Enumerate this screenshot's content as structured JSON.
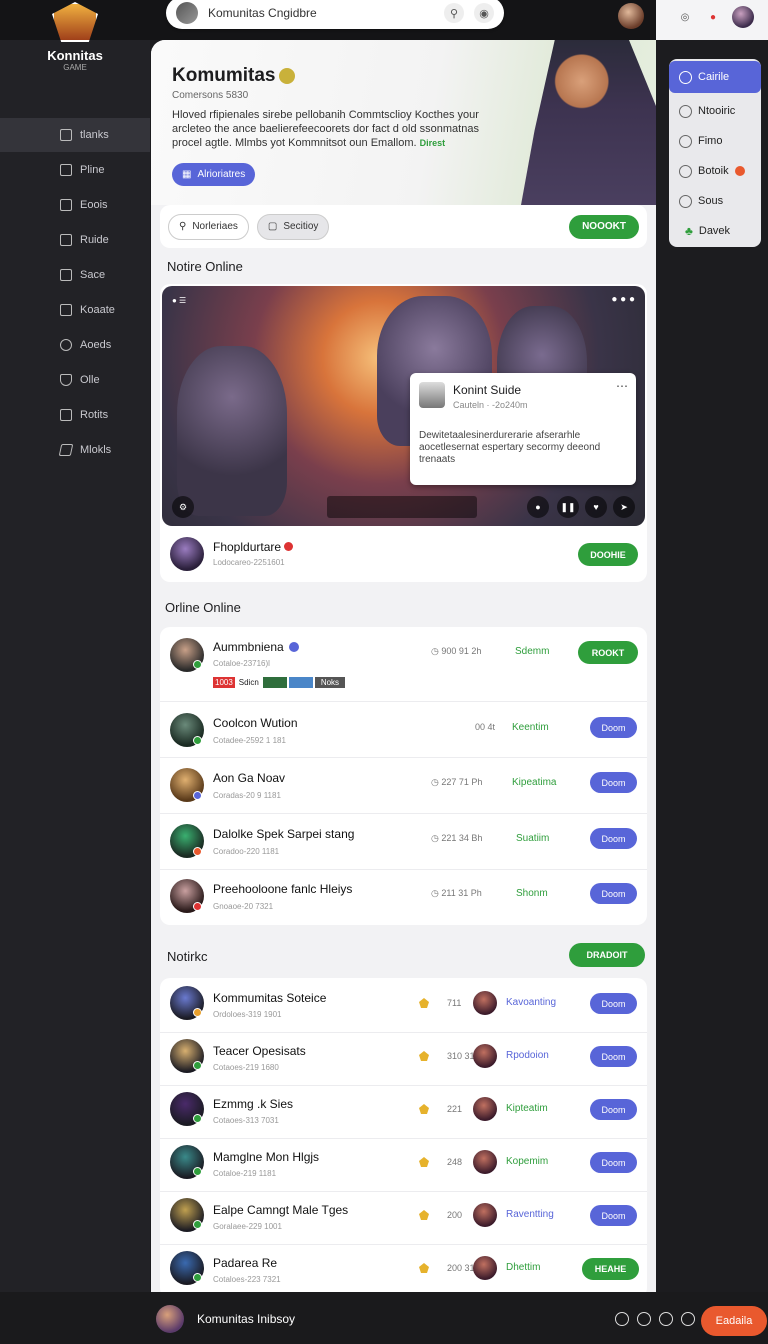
{
  "topbar": {
    "search_text": "Komunitas Cngidbre"
  },
  "sidebar": {
    "logo_title": "Konnitas",
    "logo_sub": "GAME",
    "items": [
      {
        "label": "tlanks"
      },
      {
        "label": "Pline"
      },
      {
        "label": "Eoois"
      },
      {
        "label": "Ruide"
      },
      {
        "label": "Sace"
      },
      {
        "label": "Koaate"
      },
      {
        "label": "Aoeds"
      },
      {
        "label": "Olle"
      },
      {
        "label": "Rotits"
      },
      {
        "label": "Mlokls"
      }
    ]
  },
  "hero": {
    "title": "Komumitas",
    "subtitle": "Comersons 5830",
    "description": "Hloved rfipienales sirebe pellobanih Commtsclioy Kocthes your arcleteo the ance baelierefeecoorets dor fact d old ssonmatnas procel agtle. Mlmbs yot Kommnitsot oun Emallom.",
    "description_tag": "Direst",
    "pill_label": "Alrioriatres"
  },
  "filter": {
    "chip1": "Norleriaes",
    "chip2": "Secitioy",
    "action": "NOOOKT"
  },
  "section1": {
    "title": "Notire Online",
    "popup": {
      "name": "Konint Suide",
      "sub": "Cauteln  ·  -2o240m",
      "text": "Dewitetaalesinerdurerarie afserarhle aocetlesernat espertary secormy deeond trenaats"
    },
    "featured": {
      "name": "Fhopldurtare",
      "sub": "Lodocareo-2251601",
      "button": "DOOHIE"
    }
  },
  "section2": {
    "title": "Orline Online",
    "rows": [
      {
        "name": "Aummbniena",
        "sub": "Cotaloe-23716)l",
        "stat": "900  91 2h",
        "link": "Sdemm",
        "button": "ROOKT",
        "tags": [
          "1003",
          "Sdicn",
          "  ",
          "Noks"
        ]
      },
      {
        "name": "Coolcon Wution",
        "sub": "Cotadee-2592 1 181",
        "stat": "00 4t",
        "link": "Keentim",
        "button": "Doom"
      },
      {
        "name": "Aon Ga Noav",
        "sub": "Coradas-20 9 1181",
        "stat": "227  71 Ph",
        "link": "Kipeatima",
        "button": "Doom"
      },
      {
        "name": "Dalolke Spek Sarpei stang",
        "sub": "Coradoo-220 1181",
        "stat": "221  34 Bh",
        "link": "Suatiim",
        "button": "Doom"
      },
      {
        "name": "Preehooloone fanlc Hleiys",
        "sub": "Gnoaoe-20 7321",
        "stat": "211  31 Ph",
        "link": "Shonm",
        "button": "Doom"
      }
    ]
  },
  "section3": {
    "title": "Notirkc",
    "header_button": "DRADOIT",
    "rows": [
      {
        "name": "Kommumitas Soteice",
        "sub": "Ordoloes-319 1901",
        "stat": "711",
        "link": "Kavoanting",
        "button": "Doom",
        "style": "blue"
      },
      {
        "name": "Teacer Opesisats",
        "sub": "Cotaoes-219 1680",
        "stat": "310  31 Ph",
        "link": "Rpodoion",
        "button": "Doom",
        "style": "blue"
      },
      {
        "name": "Ezmmg .k Sies",
        "sub": "Cotaoes-313 7031",
        "stat": "221",
        "link": "Kipteatim",
        "button": "Doom",
        "style": "blue"
      },
      {
        "name": "Mamglne Mon Hlgjs",
        "sub": "Cotaloe-219 1181",
        "stat": "248",
        "link": "Kopemim",
        "button": "Doom",
        "style": "blue"
      },
      {
        "name": "Ealpe Camngt Male Tges",
        "sub": "Goralaee-229 1001",
        "stat": "200",
        "link": "Raventting",
        "button": "Doom",
        "style": "blue"
      },
      {
        "name": "Padarea Re",
        "sub": "Cotaloes-223 7321",
        "stat": "200  31 Ph",
        "link": "Dhettim",
        "button": "HEAHE",
        "style": "green"
      }
    ]
  },
  "rightpanel": {
    "items": [
      {
        "label": "Cairile"
      },
      {
        "label": "Ntooiric"
      },
      {
        "label": "Fimo"
      },
      {
        "label": "Botoik"
      },
      {
        "label": "Sous"
      },
      {
        "label": "Davek"
      }
    ]
  },
  "bottombar": {
    "label": "Komunitas Inibsoy",
    "button": "Eadaila"
  },
  "colors": {
    "accent_blue": "#5865d8",
    "accent_green": "#2f9e3c",
    "accent_orange": "#e9592e"
  }
}
